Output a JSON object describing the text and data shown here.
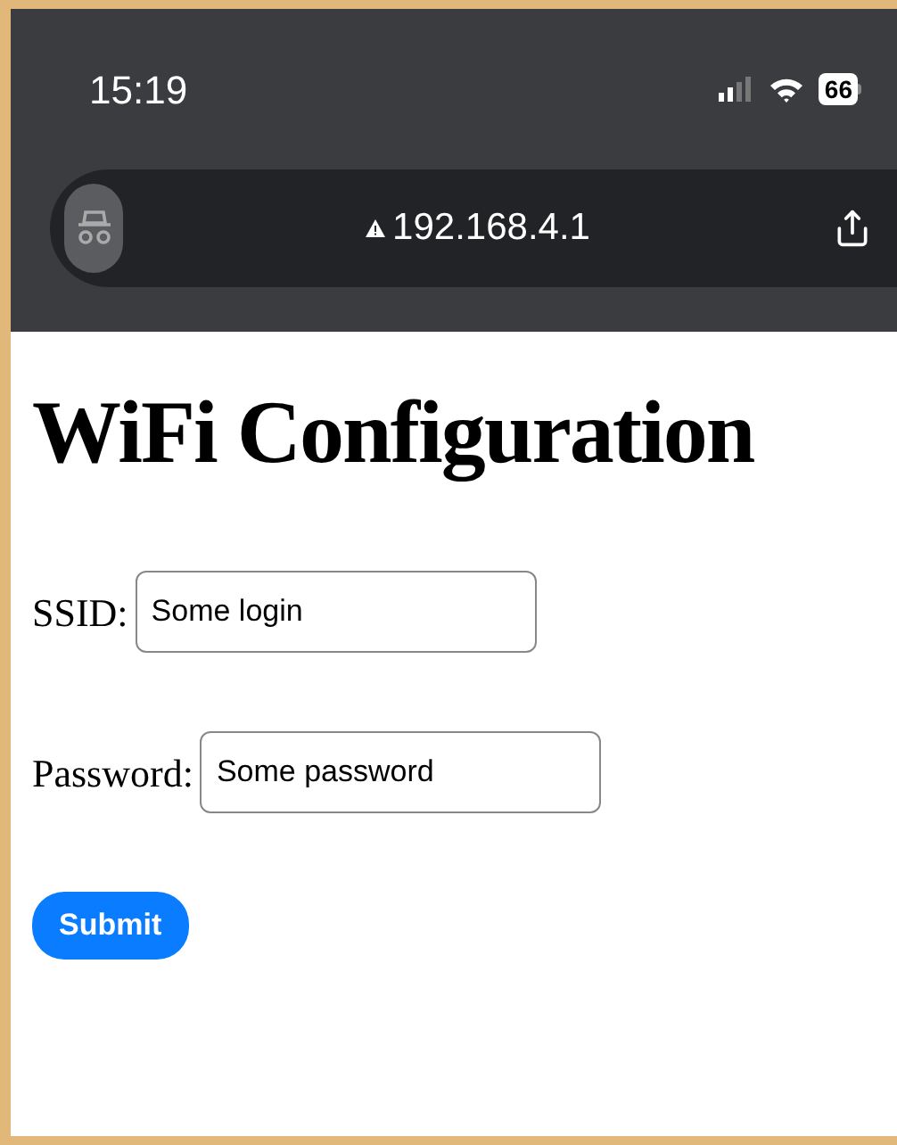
{
  "status_bar": {
    "time": "15:19",
    "battery": "66"
  },
  "address_bar": {
    "url": "192.168.4.1",
    "insecure": true
  },
  "page": {
    "title": "WiFi Configuration",
    "fields": [
      {
        "label": "SSID:",
        "value": "Some login"
      },
      {
        "label": "Password:",
        "value": "Some password"
      }
    ],
    "submit": "Submit"
  }
}
